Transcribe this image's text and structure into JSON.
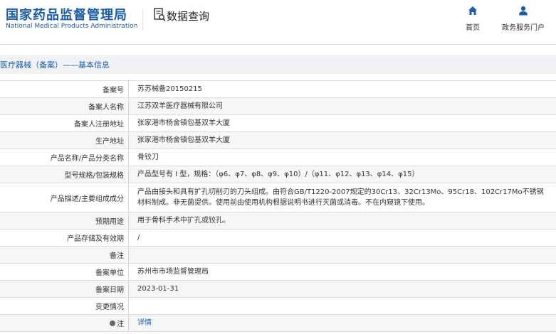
{
  "header": {
    "logo_cn": "国家药品监督管理局",
    "logo_en": "National Medical Products Administration",
    "query_title": "数据查询",
    "nav": {
      "home": "首页",
      "portal": "政务服务门户"
    }
  },
  "breadcrumb": "医疗器械（备案）——基本信息",
  "rows": [
    {
      "label": "备案号",
      "value": "苏苏械备20150215"
    },
    {
      "label": "备案人名称",
      "value": "江苏双羊医疗器械有限公司"
    },
    {
      "label": "备案人注册地址",
      "value": "张家港市杨舍镇包基双羊大厦"
    },
    {
      "label": "生产地址",
      "value": "张家港市杨舍镇包基双羊大厦"
    },
    {
      "label": "产品名称/产品分类名称",
      "value": "骨铰刀"
    },
    {
      "label": "型号规格/包装规格",
      "value": "产品型号有 I 型，规格：（φ6、φ7、φ8、φ9、φ10）/（φ11、φ12、φ13、φ14、φ15）"
    },
    {
      "label": "产品描述/主要组成成分",
      "value": "产品由接头和具有扩孔切削刃的刀头组成。由符合GB/T1220-2007规定的30Cr13、32Cr13Mo、95Cr18、102Cr17Mo不锈钢材料制成。非无菌提供。使用前由使用机构根据说明书进行灭菌或消毒。不在内窥镜下使用。"
    },
    {
      "label": "预期用途",
      "value": "用于骨科手术中扩孔或铰孔。"
    },
    {
      "label": "产品存储及有效期",
      "value": "/"
    },
    {
      "label": "备注",
      "value": ""
    },
    {
      "label": "备案单位",
      "value": "苏州市市场监督管理局"
    },
    {
      "label": "备案日期",
      "value": "2023-01-31"
    },
    {
      "label": "变更情况",
      "value": ""
    },
    {
      "label": "注",
      "value": "详情"
    }
  ],
  "colors": {
    "brand": "#1a5ea8",
    "row_alt": "#f5f6f8",
    "border": "#dcdcdc"
  }
}
